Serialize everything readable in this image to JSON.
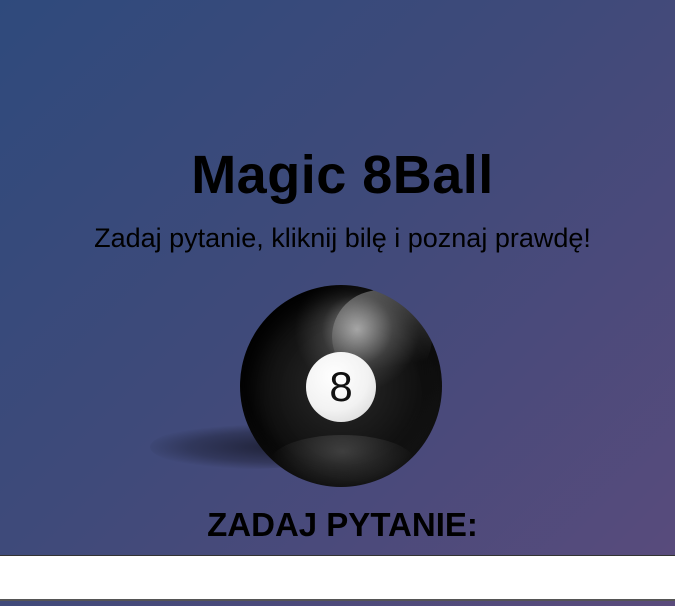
{
  "header": {
    "title": "Magic 8Ball",
    "subtitle": "Zadaj pytanie, kliknij bilę i poznaj prawdę!"
  },
  "ball": {
    "number": "8"
  },
  "question": {
    "label": "ZADAJ PYTANIE:",
    "value": "",
    "placeholder": ""
  },
  "colors": {
    "background_start": "#2f4a7c",
    "background_end": "#5a4b7c",
    "ball": "#000000",
    "ball_window": "#ffffff"
  }
}
